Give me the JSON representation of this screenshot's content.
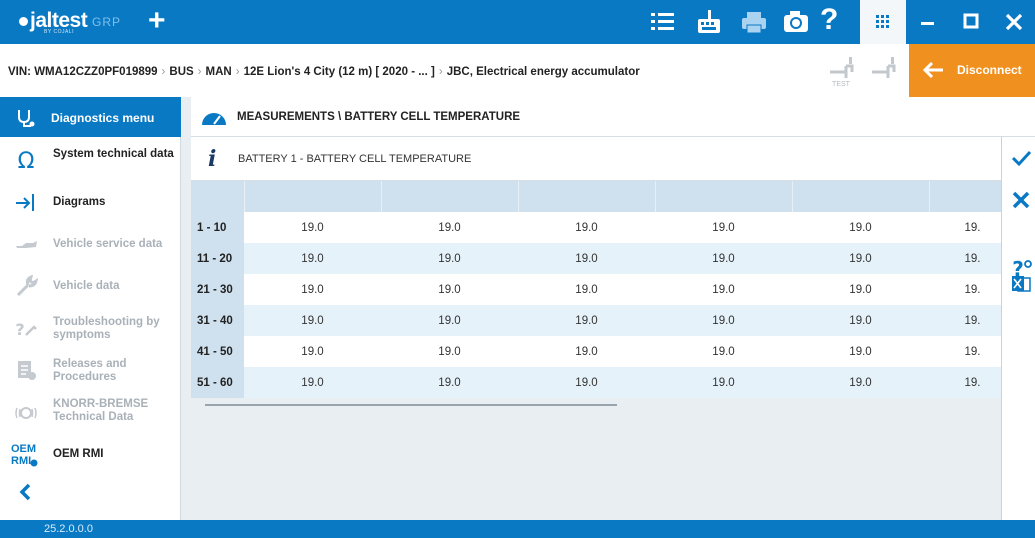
{
  "app": {
    "logo": "jaltest",
    "logo_sub": "BY COJALI",
    "grp_label": "GRP",
    "version": "25.2.0.0.0"
  },
  "toolbar": {
    "icons": [
      "menu-list-icon",
      "keyboard-icon",
      "printer-icon",
      "camera-icon",
      "help-icon",
      "apps-grid-icon",
      "minimize-icon",
      "maximize-icon",
      "close-icon"
    ],
    "help_label": "?"
  },
  "vehicle_bar": {
    "vin": "VIN: WMA12CZZ0PF019899",
    "crumbs": [
      "BUS",
      "MAN",
      "12E Lion's 4 City (12 m) [ 2020 - ... ]",
      "JBC, Electrical energy accumulator"
    ],
    "test_label": "TEST",
    "disconnect_label": "Disconnect"
  },
  "sidebar": {
    "header": "Diagnostics menu",
    "items": [
      {
        "label": "System technical data",
        "enabled": true,
        "icon": "omega-icon"
      },
      {
        "label": "Diagrams",
        "enabled": true,
        "icon": "diagram-arrow-icon"
      },
      {
        "label": "Vehicle service data",
        "enabled": false,
        "icon": "oil-can-icon"
      },
      {
        "label": "Vehicle data",
        "enabled": false,
        "icon": "wrench-icon"
      },
      {
        "label": "Troubleshooting by symptoms",
        "enabled": false,
        "icon": "troubleshoot-icon"
      },
      {
        "label": "Releases and Procedures",
        "enabled": false,
        "icon": "procedures-icon"
      },
      {
        "label": "KNORR-BREMSE Technical Data",
        "enabled": false,
        "icon": "knorr-icon"
      },
      {
        "label": "OEM RMI",
        "enabled": true,
        "icon": "oem-rmi-icon"
      }
    ],
    "oem_logo_text": "OEM RMI",
    "back_icon": "chevron-left-icon"
  },
  "content": {
    "breadcrumb": "MEASUREMENTS \\ BATTERY CELL TEMPERATURE",
    "info_title": "BATTERY 1 - BATTERY CELL TEMPERATURE",
    "info_icon": "i",
    "table": {
      "columns": [
        "",
        "",
        "",
        "",
        "",
        ""
      ],
      "rows": [
        {
          "label": "1 - 10",
          "values": [
            "19.0",
            "19.0",
            "19.0",
            "19.0",
            "19.0",
            "19."
          ]
        },
        {
          "label": "11 - 20",
          "values": [
            "19.0",
            "19.0",
            "19.0",
            "19.0",
            "19.0",
            "19."
          ]
        },
        {
          "label": "21 - 30",
          "values": [
            "19.0",
            "19.0",
            "19.0",
            "19.0",
            "19.0",
            "19."
          ]
        },
        {
          "label": "31 - 40",
          "values": [
            "19.0",
            "19.0",
            "19.0",
            "19.0",
            "19.0",
            "19."
          ]
        },
        {
          "label": "41 - 50",
          "values": [
            "19.0",
            "19.0",
            "19.0",
            "19.0",
            "19.0",
            "19."
          ]
        },
        {
          "label": "51 - 60",
          "values": [
            "19.0",
            "19.0",
            "19.0",
            "19.0",
            "19.0",
            "19."
          ]
        }
      ]
    }
  },
  "right_actions": [
    "check-icon",
    "cancel-x-icon",
    "help-settings-icon",
    "export-excel-icon"
  ],
  "colors": {
    "primary": "#0a79c4",
    "accent": "#f0901e",
    "table_header": "#cfe0ee",
    "row_alt": "#e6f2fa"
  }
}
